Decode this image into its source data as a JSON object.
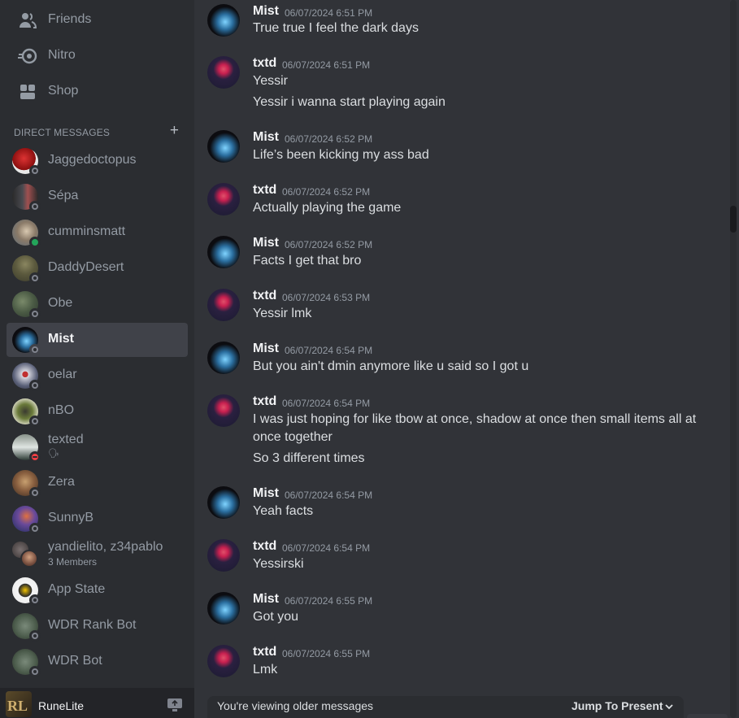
{
  "colors": {
    "sidebar_bg": "#2b2d31",
    "chat_bg": "#313338",
    "active_bg": "#404249",
    "muted_text": "#949ba4",
    "primary_text": "#f2f3f5",
    "status_online": "#23a55a",
    "status_dnd": "#f23f43",
    "status_offline": "#80848e"
  },
  "sidebar": {
    "nav": [
      {
        "label": "Friends",
        "icon": "friends-icon"
      },
      {
        "label": "Nitro",
        "icon": "nitro-icon"
      },
      {
        "label": "Shop",
        "icon": "shop-icon"
      }
    ],
    "dm_header": {
      "title": "DIRECT MESSAGES",
      "add_icon": "+"
    },
    "dms": [
      {
        "name": "Jaggedoctopus",
        "status": "offline"
      },
      {
        "name": "Sépa",
        "status": "offline"
      },
      {
        "name": "cumminsmatt",
        "status": "online"
      },
      {
        "name": "DaddyDesert",
        "status": "offline"
      },
      {
        "name": "Obe",
        "status": "offline"
      },
      {
        "name": "Mist",
        "status": "offline",
        "active": true
      },
      {
        "name": "oelar",
        "status": "offline"
      },
      {
        "name": "nBO",
        "status": "offline"
      },
      {
        "name": "texted",
        "status": "dnd",
        "custom_status_icon": "🗣"
      },
      {
        "name": "Zera",
        "status": "offline"
      },
      {
        "name": "SunnyB",
        "status": "offline"
      },
      {
        "name": "yandielito, z34pablo",
        "subtitle": "3 Members"
      },
      {
        "name": "App State",
        "status": "offline"
      },
      {
        "name": "WDR Rank Bot",
        "status": "offline"
      },
      {
        "name": "WDR Bot",
        "status": "offline"
      }
    ],
    "user_panel": {
      "name": "RuneLite",
      "icon": "screen-share-icon"
    }
  },
  "chat": {
    "messages": [
      {
        "author": "Mist",
        "time": "06/07/2024 6:51 PM",
        "lines": [
          "True true I feel the dark days"
        ]
      },
      {
        "author": "txtd",
        "time": "06/07/2024 6:51 PM",
        "lines": [
          "Yessir",
          "Yessir i wanna start playing again"
        ]
      },
      {
        "author": "Mist",
        "time": "06/07/2024 6:52 PM",
        "lines": [
          "Life’s been kicking my ass bad"
        ]
      },
      {
        "author": "txtd",
        "time": "06/07/2024 6:52 PM",
        "lines": [
          "Actually playing the game"
        ]
      },
      {
        "author": "Mist",
        "time": "06/07/2024 6:52 PM",
        "lines": [
          "Facts I get that bro"
        ]
      },
      {
        "author": "txtd",
        "time": "06/07/2024 6:53 PM",
        "lines": [
          "Yessir lmk"
        ]
      },
      {
        "author": "Mist",
        "time": "06/07/2024 6:54 PM",
        "lines": [
          "But you ain't dmin anymore like u said so I got u"
        ]
      },
      {
        "author": "txtd",
        "time": "06/07/2024 6:54 PM",
        "lines": [
          "I was just hoping for like tbow at once, shadow at once then small items all at once together",
          "So 3 different times"
        ]
      },
      {
        "author": "Mist",
        "time": "06/07/2024 6:54 PM",
        "lines": [
          "Yeah facts"
        ]
      },
      {
        "author": "txtd",
        "time": "06/07/2024 6:54 PM",
        "lines": [
          "Yessirski"
        ]
      },
      {
        "author": "Mist",
        "time": "06/07/2024 6:55 PM",
        "lines": [
          "Got you"
        ]
      },
      {
        "author": "txtd",
        "time": "06/07/2024 6:55 PM",
        "lines": [
          "Lmk"
        ]
      }
    ],
    "older_bar": {
      "text": "You're viewing older messages",
      "jump_label": "Jump To Present",
      "icon": "chevron-down-icon"
    }
  }
}
